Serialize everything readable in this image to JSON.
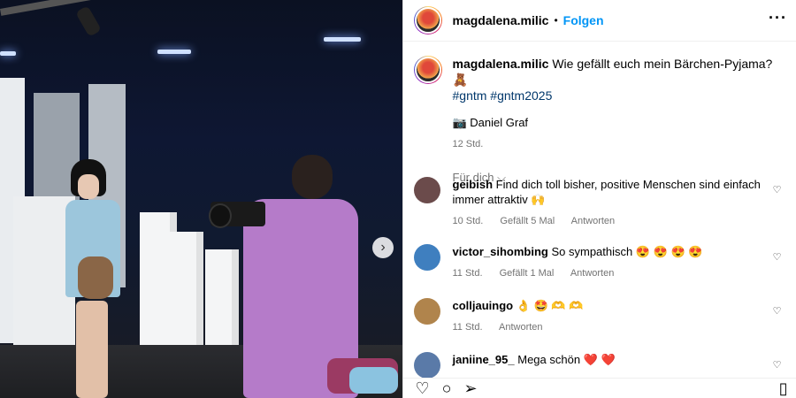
{
  "post": {
    "username": "magdalena.milic",
    "separator": "•",
    "follow_label": "Folgen",
    "more_icon": "more-horizontal-icon",
    "caption_text": "Wie gefällt euch mein Bärchen-Pyjama? 🧸",
    "hashtags": "#gntm #gntm2025",
    "credit": "📷 Daniel Graf",
    "time": "12 Std.",
    "sort_label": "Für dich ⌵"
  },
  "photo": {
    "next_icon": "chevron-right-icon",
    "next_glyph": "›"
  },
  "comments": [
    {
      "user": "geibish",
      "text": "Find dich toll bisher, positive Menschen sind einfach immer attraktiv 🙌",
      "time": "10 Std.",
      "likes": "Gefällt 5 Mal",
      "reply": "Antworten",
      "avatar_color": "#6b4b4b"
    },
    {
      "user": "victor_sihombing",
      "text": "So sympathisch 😍 😍 😍 😍",
      "time": "11 Std.",
      "likes": "Gefällt 1 Mal",
      "reply": "Antworten",
      "avatar_color": "#3f7fbf"
    },
    {
      "user": "colljauingo",
      "text": "👌 🤩 🫶 🫶",
      "time": "11 Std.",
      "likes": "",
      "reply": "Antworten",
      "avatar_color": "#b0844c"
    },
    {
      "user": "janiine_95_",
      "text": "Mega schön ❤️ ❤️",
      "time": "",
      "likes": "",
      "reply": "",
      "avatar_color": "#5a7aa8"
    }
  ],
  "actions": {
    "like_icon": "heart-icon",
    "comment_icon": "comment-icon",
    "share_icon": "share-icon",
    "save_icon": "bookmark-icon"
  },
  "colors": {
    "accent": "#0095f6",
    "hashtag": "#00376b",
    "meta": "#737373"
  }
}
